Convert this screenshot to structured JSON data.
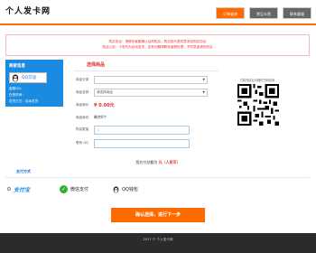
{
  "header": {
    "logo": "个人发卡网",
    "nav": [
      "订单查询",
      "常见卡密",
      "联系客服"
    ]
  },
  "notice": {
    "line1": "购买协议：请联系客服确认后再购买，购买即代表同意本站购买协议",
    "line2": "特此公告：卡密均为自动发货，如有问题请联系客服处理，不同意者请勿购买"
  },
  "sidebar": {
    "title": "商家信息",
    "qq_label": "QQ交谈",
    "rows": [
      "客服QQ：",
      "在线时间：",
      "发货方式：自动发货"
    ]
  },
  "form": {
    "section_title": "选择商品",
    "category_label": "商品分类",
    "category_value": "",
    "product_label": "商品名称",
    "product_value": "请选择商品",
    "price_label": "商品单价",
    "price_value": "¥ 0.00元",
    "stock_label": "商品库存",
    "stock_value": "剩余0个",
    "quantity_label": "购买数量",
    "quantity_value": "1",
    "contact_label": "联系 QQ",
    "contact_value": ""
  },
  "qr": {
    "caption": "付款完成后可随时扫码查询"
  },
  "total": {
    "prefix": "您应付总额为",
    "amount": "元",
    "suffix": "（人民币）"
  },
  "payment": {
    "title": "支付方式",
    "options": [
      "支付宝",
      "微信支付",
      "QQ钱包"
    ]
  },
  "confirm_button": "确认选择，进行下一步",
  "footer": "2017 © 个人发卡网",
  "colors": {
    "accent": "#ff6a00",
    "brand_blue": "#1a8be0",
    "alert_red": "#e03030"
  }
}
